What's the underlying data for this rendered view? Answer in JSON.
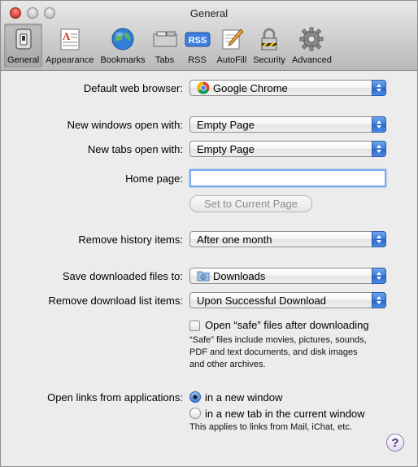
{
  "window": {
    "title": "General"
  },
  "toolbar": {
    "items": [
      {
        "label": "General",
        "icon": "general-switch-icon",
        "selected": true
      },
      {
        "label": "Appearance",
        "icon": "appearance-icon",
        "selected": false
      },
      {
        "label": "Bookmarks",
        "icon": "bookmarks-globe-icon",
        "selected": false
      },
      {
        "label": "Tabs",
        "icon": "tabs-icon",
        "selected": false
      },
      {
        "label": "RSS",
        "icon": "rss-icon",
        "selected": false
      },
      {
        "label": "AutoFill",
        "icon": "autofill-pencil-icon",
        "selected": false
      },
      {
        "label": "Security",
        "icon": "security-lock-icon",
        "selected": false
      },
      {
        "label": "Advanced",
        "icon": "advanced-gear-icon",
        "selected": false
      }
    ]
  },
  "general": {
    "default_browser": {
      "label": "Default web browser:",
      "value": "Google Chrome"
    },
    "new_windows": {
      "label": "New windows open with:",
      "value": "Empty Page"
    },
    "new_tabs": {
      "label": "New tabs open with:",
      "value": "Empty Page"
    },
    "home_page": {
      "label": "Home page:",
      "value": ""
    },
    "set_current_label": "Set to Current Page",
    "remove_history": {
      "label": "Remove history items:",
      "value": "After one month"
    },
    "save_downloads": {
      "label": "Save downloaded files to:",
      "value": "Downloads"
    },
    "remove_download_list": {
      "label": "Remove download list items:",
      "value": "Upon Successful Download"
    },
    "open_safe": {
      "label": "Open “safe” files after downloading",
      "checked": false,
      "note_line1": "“Safe” files include movies, pictures, sounds,",
      "note_line2": "PDF and text documents, and disk images",
      "note_line3": "and other archives."
    },
    "open_links": {
      "label": "Open links from applications:",
      "option1": "in a new window",
      "option2": "in a new tab in the current window",
      "selected": "in a new window",
      "note": "This applies to links from Mail, iChat, etc."
    },
    "help_label": "?"
  },
  "colors": {
    "accent": "#3c7bdb",
    "help": "#4a2d86"
  }
}
